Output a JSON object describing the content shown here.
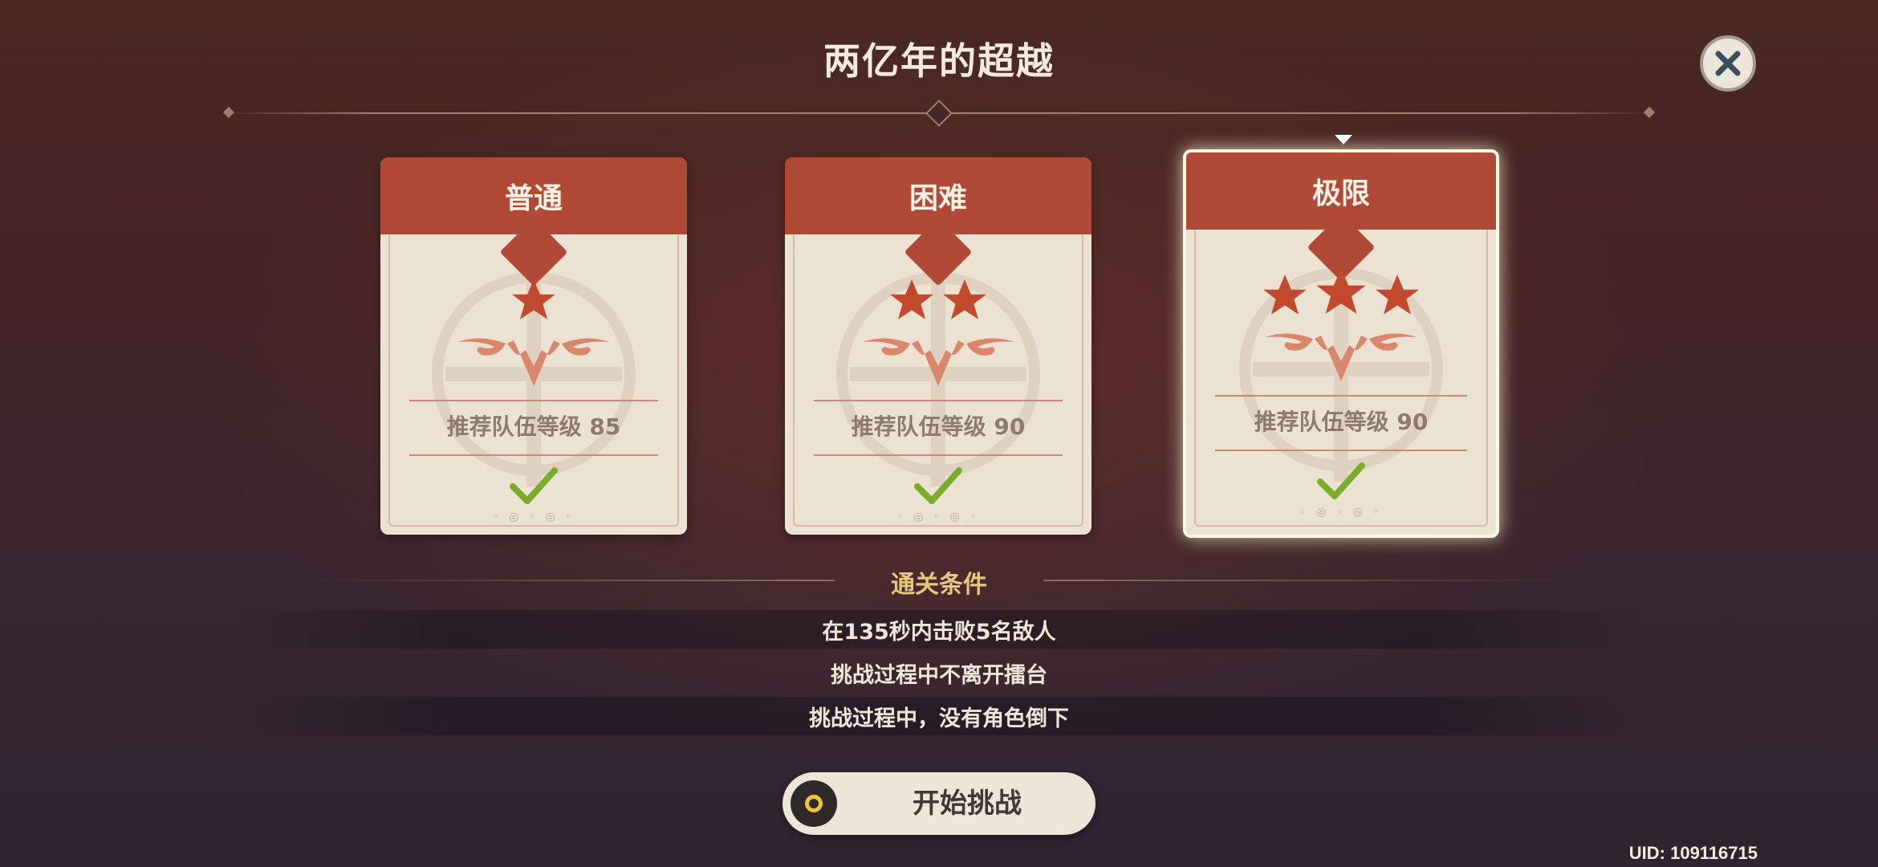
{
  "header": {
    "title": "两亿年的超越"
  },
  "close_button": {
    "icon": "close-icon"
  },
  "difficulties": [
    {
      "name": "普通",
      "stars": 1,
      "recommended_level": "推荐队伍等级 85",
      "cleared": true,
      "selected": false
    },
    {
      "name": "困难",
      "stars": 2,
      "recommended_level": "推荐队伍等级 90",
      "cleared": true,
      "selected": false
    },
    {
      "name": "极限",
      "stars": 3,
      "recommended_level": "推荐队伍等级 90",
      "cleared": true,
      "selected": true
    }
  ],
  "conditions": {
    "title": "通关条件",
    "items": [
      "在135秒内击败5名敌人",
      "挑战过程中不离开擂台",
      "挑战过程中，没有角色倒下"
    ]
  },
  "start_button": {
    "label": "开始挑战",
    "icon": "gamepad-button-icon"
  },
  "footer": {
    "uid": "UID: 109116715"
  },
  "colors": {
    "accent_red": "#b04a36",
    "card_bg": "#ece2d2",
    "gold": "#e6c77d",
    "check_green": "#7bab2c"
  }
}
